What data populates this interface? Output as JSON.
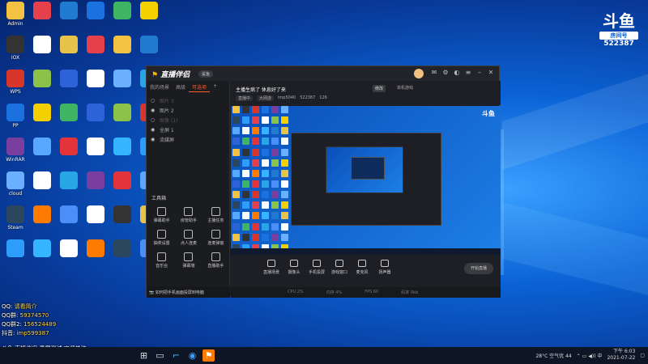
{
  "badge": {
    "logo": "斗鱼",
    "room_label": "房间号",
    "room_number": "522387"
  },
  "desktop_icons": [
    {
      "label": "Admin",
      "color": "#f3c242"
    },
    {
      "label": "IOX",
      "color": "#333"
    },
    {
      "label": "WPS",
      "color": "#d9362b"
    },
    {
      "label": "PP",
      "color": "#1b71e0"
    },
    {
      "label": "WinRAR",
      "color": "#7a3f9e"
    },
    {
      "label": "cloud",
      "color": "#6ab0ff"
    },
    {
      "label": "Steam",
      "color": "#2a475e"
    },
    {
      "label": "",
      "color": "#2d9dfb"
    },
    {
      "label": "",
      "color": "#e6404c"
    },
    {
      "label": "",
      "color": "#ffffff"
    },
    {
      "label": "",
      "color": "#8bc34a"
    },
    {
      "label": "",
      "color": "#f5d000"
    },
    {
      "label": "",
      "color": "#58a8ff"
    },
    {
      "label": "",
      "color": "#fff"
    },
    {
      "label": "",
      "color": "#ff7a00"
    },
    {
      "label": "",
      "color": "#35b5ff"
    },
    {
      "label": "",
      "color": "#1f7ad0"
    },
    {
      "label": "",
      "color": "#e8c34a"
    },
    {
      "label": "",
      "color": "#2e62d9"
    },
    {
      "label": "",
      "color": "#3fb463"
    },
    {
      "label": "",
      "color": "#e3343a"
    },
    {
      "label": "",
      "color": "#27a6e5"
    },
    {
      "label": "",
      "color": "#4c8ef7"
    },
    {
      "label": "",
      "color": "#fff"
    }
  ],
  "window": {
    "app_name": "直播伴侣",
    "version_badge": "鲨鱼",
    "tabs": [
      "我的场景",
      "高级",
      "可选项"
    ],
    "sources": [
      {
        "label": "图片 3",
        "visible": false
      },
      {
        "label": "图片 2",
        "visible": true
      },
      {
        "label": "图像 (1)",
        "visible": false
      },
      {
        "label": "全屏 1",
        "visible": true
      },
      {
        "label": "流媒屏",
        "visible": true
      }
    ],
    "tools_header": "工具箱",
    "tools": [
      "弹幕助手",
      "房管助手",
      "主播任务",
      "抽奖设置",
      "点人连麦",
      "连麦弹窗",
      "音乐台",
      "弹幕墙",
      "直播助手"
    ],
    "notice": "如何把手机画面投屏到电脑",
    "stream_title": "主播生病了 休息好了来",
    "edit_label": "修改",
    "category": "单机游戏",
    "info": [
      "直播中",
      "大网游",
      "imp5040",
      "522387",
      "126"
    ],
    "controls": [
      "直播场景",
      "摄像头",
      "手机投屏",
      "游戏窗口",
      "麦克风",
      "扬声器"
    ],
    "start_label": "开始直播",
    "stats": [
      "CPU 2%",
      "内存 4%",
      "FPS 60",
      "码率 0kb"
    ]
  },
  "overlay": {
    "lines": [
      {
        "label": "QQ",
        "value": "请看简介"
      },
      {
        "label": "QQ群",
        "value": "59374570"
      },
      {
        "label": "QQ群2",
        "value": "156524489"
      },
      {
        "label": "抖音",
        "value": "imp599387"
      }
    ],
    "subtitle": "斗鱼 直播伴侣 录屏测试 欢迎关注"
  },
  "taskbar": {
    "weather": "28°C 空气优 44",
    "time": "下午 6:03",
    "date": "2021-07-22"
  }
}
